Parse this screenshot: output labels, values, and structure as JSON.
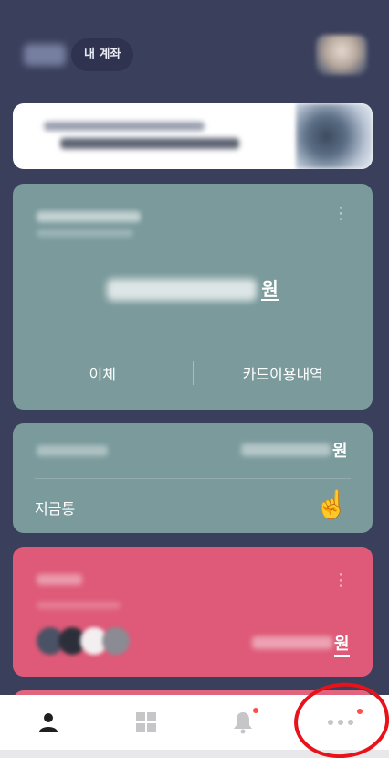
{
  "header": {
    "account_pill": "내 계좌"
  },
  "card1": {
    "currency": "원",
    "actions": [
      "이체",
      "카드이용내역"
    ]
  },
  "card2": {
    "currency": "원",
    "label": "저금통",
    "emoji": "☝️"
  },
  "card3": {
    "currency": "원"
  },
  "tabbar": {
    "items": [
      "person-icon",
      "grid-icon",
      "bell-icon",
      "more-icon"
    ],
    "active_color": "#1f1f1f",
    "inactive_color": "#c6c6c9",
    "badge_color": "#ff4d4d"
  },
  "colors": {
    "background": "#3a3f5c",
    "card_teal": "#7a9a9c",
    "card_pink": "#de5a78"
  }
}
